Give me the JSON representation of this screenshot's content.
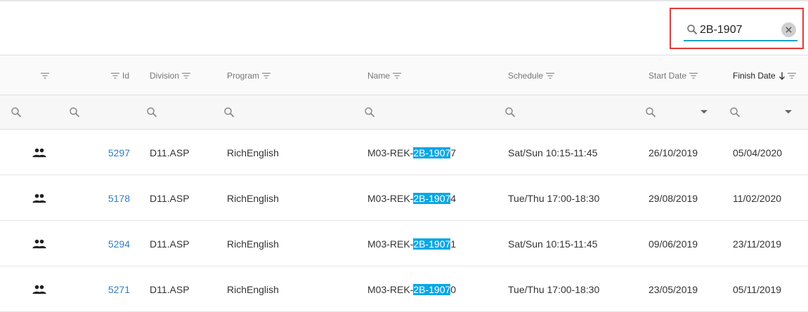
{
  "search": {
    "value": "2B-1907"
  },
  "columns": [
    {
      "key": "group",
      "label": ""
    },
    {
      "key": "id",
      "label": "Id"
    },
    {
      "key": "division",
      "label": "Division"
    },
    {
      "key": "program",
      "label": "Program"
    },
    {
      "key": "name",
      "label": "Name"
    },
    {
      "key": "schedule",
      "label": "Schedule"
    },
    {
      "key": "start_date",
      "label": "Start Date"
    },
    {
      "key": "finish_date",
      "label": "Finish Date"
    }
  ],
  "rows": [
    {
      "icon": "group-icon",
      "id": "5297",
      "division": "D11.ASP",
      "program": "RichEnglish",
      "name_prefix": "M03-REK-",
      "name_match": "2B-1907",
      "name_suffix": "7",
      "schedule": "Sat/Sun 10:15-11:45",
      "start_date": "26/10/2019",
      "finish_date": "05/04/2020"
    },
    {
      "icon": "group-icon",
      "id": "5178",
      "division": "D11.ASP",
      "program": "RichEnglish",
      "name_prefix": "M03-REK-",
      "name_match": "2B-1907",
      "name_suffix": "4",
      "schedule": "Tue/Thu 17:00-18:30",
      "start_date": "29/08/2019",
      "finish_date": "11/02/2020"
    },
    {
      "icon": "group-icon",
      "id": "5294",
      "division": "D11.ASP",
      "program": "RichEnglish",
      "name_prefix": "M03-REK-",
      "name_match": "2B-1907",
      "name_suffix": "1",
      "schedule": "Sat/Sun 10:15-11:45",
      "start_date": "09/06/2019",
      "finish_date": "23/11/2019"
    },
    {
      "icon": "group-icon",
      "id": "5271",
      "division": "D11.ASP",
      "program": "RichEnglish",
      "name_prefix": "M03-REK-",
      "name_match": "2B-1907",
      "name_suffix": "0",
      "schedule": "Tue/Thu 17:00-18:30",
      "start_date": "23/05/2019",
      "finish_date": "05/11/2019"
    }
  ],
  "colors": {
    "highlight": "#0aa7e6",
    "link": "#2d7cc7",
    "search_underline": "#1aa3c6",
    "annotation_box": "#e53935"
  }
}
